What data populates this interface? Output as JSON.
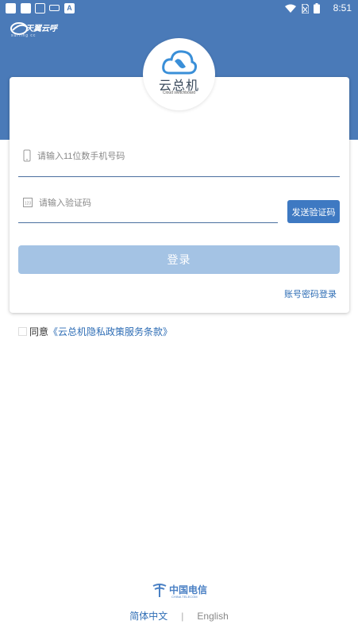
{
  "status_bar": {
    "time": "8:51",
    "icons": [
      "square-icon",
      "square-icon",
      "image-icon",
      "keyboard-icon",
      "a-icon",
      "wifi-icon",
      "sim-icon",
      "battery-icon"
    ]
  },
  "brand": {
    "name": "天翼云呼",
    "sub": "surfing cc"
  },
  "app": {
    "name": "云总机",
    "subtitle": "Cloud switchboard"
  },
  "login_form": {
    "phone_placeholder": "请输入11位数手机号码",
    "code_placeholder": "请输入验证码",
    "send_code_label": "发送验证码",
    "login_label": "登录",
    "password_login_link": "账号密码登录"
  },
  "agreement": {
    "prefix": "同意",
    "link": "《云总机隐私政策服务条款》"
  },
  "footer": {
    "operator_name": "中国电信",
    "operator_sub": "CHINA TELECOM",
    "lang_zh": "简体中文",
    "lang_sep": "|",
    "lang_en": "English"
  },
  "colors": {
    "header": "#4a7ab8",
    "primary": "#3e79c2",
    "login_disabled": "#a4c3e4",
    "link": "#2e6db5"
  }
}
